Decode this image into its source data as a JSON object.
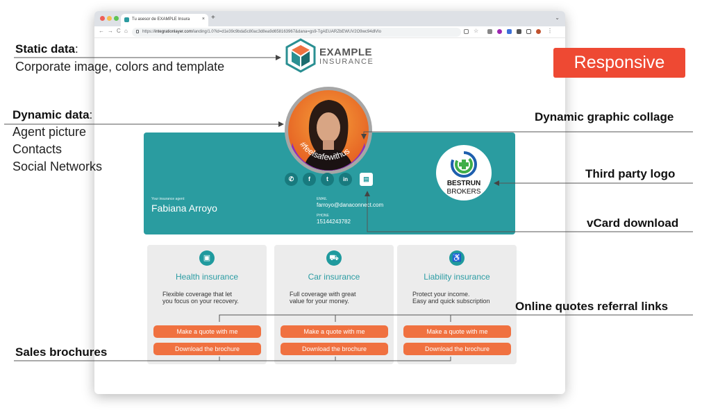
{
  "browser": {
    "tab_title": "Tu asesor de EXAMPLE Insura",
    "tab_close": "×",
    "new_tab": "+",
    "tab_chevron": "⌄",
    "nav_back": "←",
    "nav_forward": "→",
    "nav_reload": "C",
    "nav_home": "⌂",
    "url_prefix": "https://",
    "url_host": "integrationlayer.com",
    "url_path": "/landing/1.0?id=d1e39c9bda5c80ac3d8ea9d658163967&dana=gs9-TgAEUARZbEWUV2O9wc94dlVlo"
  },
  "logo": {
    "word1": "EXAMPLE",
    "word2": "INSURANCE"
  },
  "hashtag": "#feelsafewithus",
  "social_icons": [
    "whatsapp-icon",
    "facebook-icon",
    "twitter-icon",
    "linkedin-icon",
    "vcard-icon"
  ],
  "agent": {
    "caption": "Your insurance agent:",
    "name": "Fabiana Arroyo",
    "email_label": "EMAIL",
    "email": "farroyo@danaconnect.com",
    "phone_label": "PHONE",
    "phone": "15144243782"
  },
  "broker": {
    "line1": "BESTRUN",
    "line2": "BROKERS"
  },
  "cards": [
    {
      "icon": "clipboard-icon",
      "title": "Health insurance",
      "desc1": "Flexible coverage that let",
      "desc2": "you focus on your recovery.",
      "quote": "Make a quote with me",
      "brochure": "Download the brochure"
    },
    {
      "icon": "car-icon",
      "title": "Car insurance",
      "desc1": "Full coverage with great",
      "desc2": "value for your money.",
      "quote": "Make a quote with me",
      "brochure": "Download the brochure"
    },
    {
      "icon": "wheelchair-icon",
      "title": "Liability insurance",
      "desc1": "Protect your income.",
      "desc2": "Easy and quick subscription",
      "quote": "Make a quote with me",
      "brochure": "Download the brochure"
    }
  ],
  "annotations": {
    "static_title": "Static data",
    "static_colon": ":",
    "static_desc": "Corporate image, colors and template",
    "dynamic_title": "Dynamic data",
    "dynamic_colon": ":",
    "dynamic_items": [
      "Agent picture",
      "Contacts",
      "Social Networks"
    ],
    "responsive": "Responsive",
    "collage": "Dynamic graphic collage",
    "third_party": "Third party logo",
    "vcard": "vCard download",
    "quotes": "Online quotes referral links",
    "brochures": "Sales brochures"
  },
  "colors": {
    "teal": "#2a9ca0",
    "orange": "#f07140",
    "purple": "#8b2dc1",
    "red_badge": "#ee4933"
  }
}
